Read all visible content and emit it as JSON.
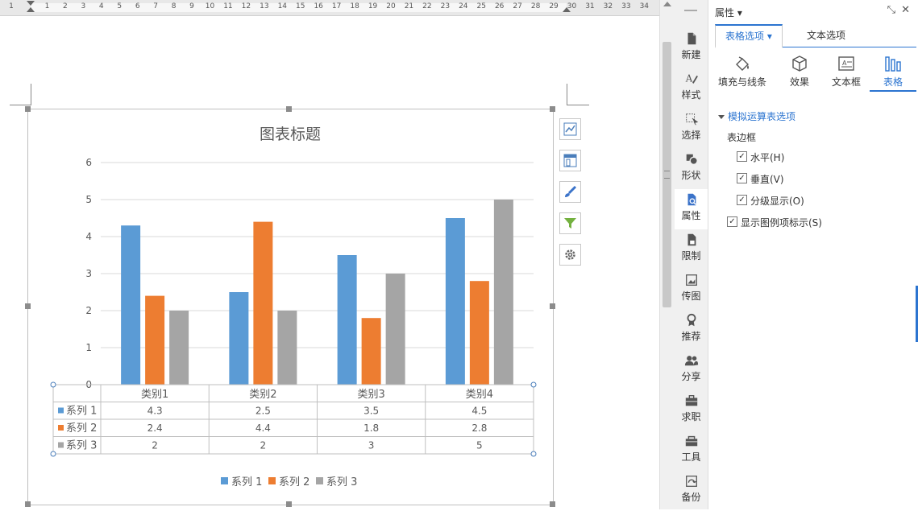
{
  "ruler": {
    "ticks": [
      "1",
      "1",
      "2",
      "3",
      "4",
      "5",
      "6",
      "7",
      "8",
      "9",
      "10",
      "11",
      "12",
      "13",
      "14",
      "15",
      "16",
      "17",
      "18",
      "19",
      "20",
      "21",
      "22",
      "23",
      "24",
      "25",
      "26",
      "27",
      "28",
      "29",
      "30",
      "31",
      "32",
      "33",
      "34"
    ]
  },
  "sidebar": {
    "items": [
      {
        "label": "新建",
        "icon": "new-file-icon"
      },
      {
        "label": "样式",
        "icon": "style-icon"
      },
      {
        "label": "选择",
        "icon": "select-icon"
      },
      {
        "label": "形状",
        "icon": "shape-icon"
      },
      {
        "label": "属性",
        "icon": "property-icon"
      },
      {
        "label": "限制",
        "icon": "restrict-icon"
      },
      {
        "label": "传图",
        "icon": "upload-image-icon"
      },
      {
        "label": "推荐",
        "icon": "recommend-icon"
      },
      {
        "label": "分享",
        "icon": "share-icon"
      },
      {
        "label": "求职",
        "icon": "job-icon"
      },
      {
        "label": "工具",
        "icon": "toolbox-icon"
      },
      {
        "label": "备份",
        "icon": "backup-icon"
      }
    ]
  },
  "panel": {
    "title": "属性 ▾",
    "tabs": [
      "表格选项 ▾",
      "文本选项"
    ],
    "subtabs": [
      {
        "label": "填充与线条",
        "icon": "fill-icon"
      },
      {
        "label": "效果",
        "icon": "effect-icon"
      },
      {
        "label": "文本框",
        "icon": "textbox-icon"
      },
      {
        "label": "表格",
        "icon": "table-chart-icon"
      }
    ],
    "section": "模拟运算表选项",
    "border_label": "表边框",
    "checks": [
      "水平(H)",
      "垂直(V)",
      "分级显示(O)"
    ],
    "legend_check": "显示图例项标示(S)",
    "accent": "#2b74d0"
  },
  "chart_data": {
    "type": "bar",
    "title": "图表标题",
    "categories": [
      "类别1",
      "类别2",
      "类别3",
      "类别4"
    ],
    "series": [
      {
        "name": "系列 1",
        "values": [
          4.3,
          2.5,
          3.5,
          4.5
        ],
        "color": "#5b9bd5"
      },
      {
        "name": "系列 2",
        "values": [
          2.4,
          4.4,
          1.8,
          2.8
        ],
        "color": "#ed7d31"
      },
      {
        "name": "系列 3",
        "values": [
          2,
          2,
          3,
          5
        ],
        "color": "#a5a5a5"
      }
    ],
    "ylim": [
      0,
      6
    ],
    "yticks": [
      "0",
      "1",
      "2",
      "3",
      "4",
      "5",
      "6"
    ],
    "grid": true,
    "legend": "bottom",
    "data_table": {
      "row_labels": [
        "系列 1",
        "系列 2",
        "系列 3"
      ],
      "rows": [
        [
          "4.3",
          "2.5",
          "3.5",
          "4.5"
        ],
        [
          "2.4",
          "4.4",
          "1.8",
          "2.8"
        ],
        [
          "2",
          "2",
          "3",
          "5"
        ]
      ]
    }
  }
}
